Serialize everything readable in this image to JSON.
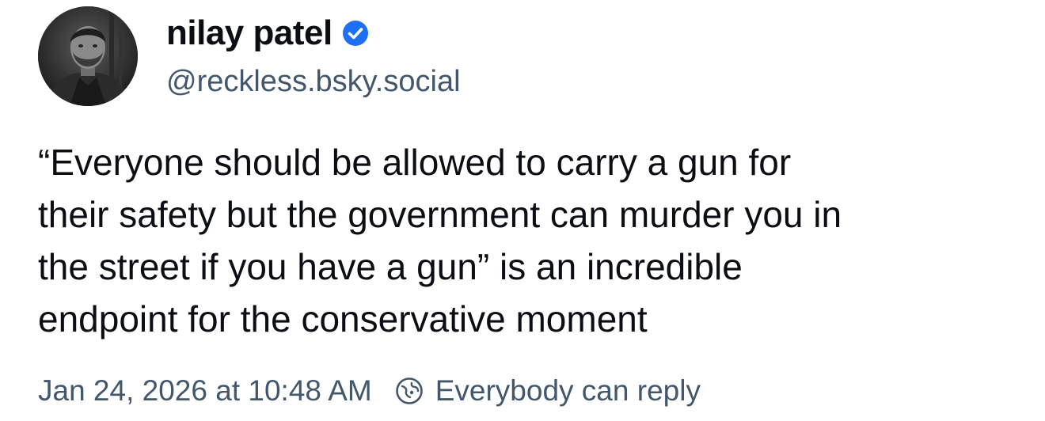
{
  "author": {
    "display_name": "nilay patel",
    "handle": "@reckless.bsky.social",
    "avatar_icon": "person-photo-avatar",
    "verified_icon": "verified-check-icon",
    "verified_color": "#1d70f5"
  },
  "post": {
    "text": "“Everyone should be allowed to carry a gun for\ntheir safety but the government can murder you in\nthe street if you have a gun” is an incredible\nendpoint for the conservative moment"
  },
  "meta": {
    "timestamp": "Jan 24, 2026 at 10:48 AM",
    "reply_icon": "reply-settings-icon",
    "reply_setting": "Everybody can reply"
  },
  "colors": {
    "text_primary": "#0b0f14",
    "text_secondary": "#42576c",
    "background": "#ffffff"
  }
}
